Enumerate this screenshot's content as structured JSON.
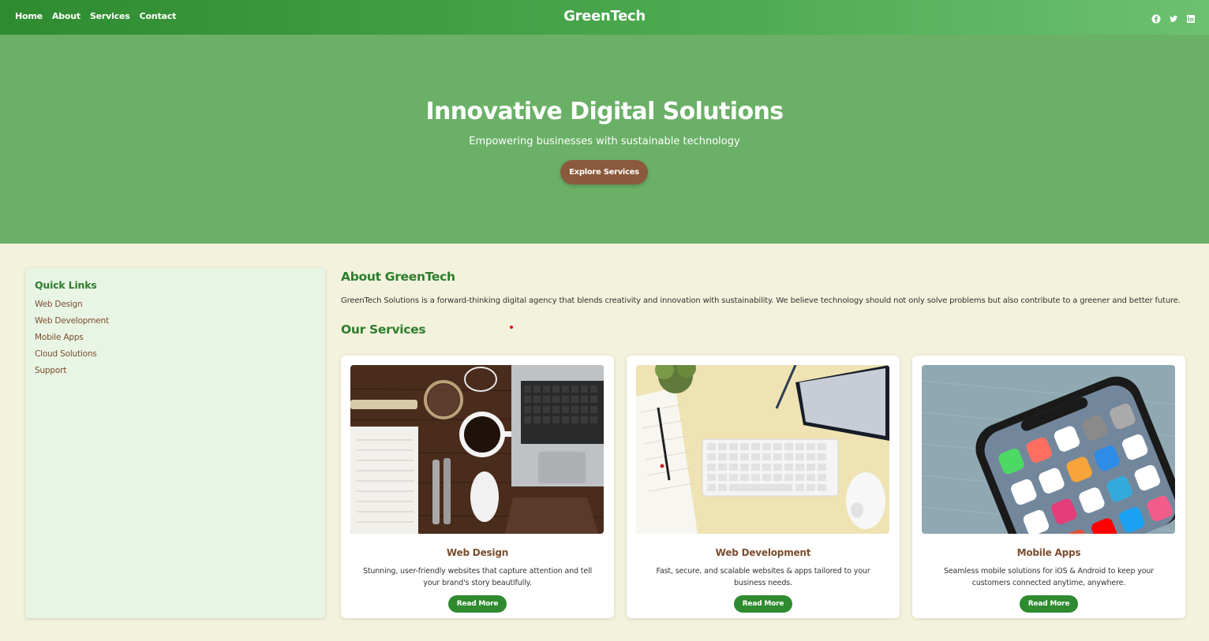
{
  "nav": {
    "links": [
      "Home",
      "About",
      "Services",
      "Contact"
    ],
    "brand": "GreenTech",
    "social_icons": [
      "facebook-icon",
      "twitter-icon",
      "linkedin-icon"
    ]
  },
  "hero": {
    "title": "Innovative Digital Solutions",
    "subtitle": "Empowering businesses with sustainable technology",
    "cta_label": "Explore Services"
  },
  "sidebar": {
    "title": "Quick Links",
    "links": [
      "Web Design",
      "Web Development",
      "Mobile Apps",
      "Cloud Solutions",
      "Support"
    ]
  },
  "about": {
    "title": "About GreenTech",
    "text": "GreenTech Solutions is a forward-thinking digital agency that blends creativity and innovation with sustainability. We believe technology should not only solve problems but also contribute to a greener and better future."
  },
  "services": {
    "title": "Our Services",
    "cards": [
      {
        "title": "Web Design",
        "description": "Stunning, user-friendly websites that capture attention and tell your brand's story beautifully.",
        "button": "Read More"
      },
      {
        "title": "Web Development",
        "description": "Fast, secure, and scalable websites & apps tailored to your business needs.",
        "button": "Read More"
      },
      {
        "title": "Mobile Apps",
        "description": "Seamless mobile solutions for iOS & Android to keep your customers connected anytime, anywhere.",
        "button": "Read More"
      }
    ]
  },
  "colors": {
    "nav_green": "#2e8b2f",
    "hero_green": "#6bb067",
    "brown_accent": "#8b5a3c",
    "page_bg": "#f3f2dc",
    "sidebar_bg": "#e8f5e4"
  }
}
